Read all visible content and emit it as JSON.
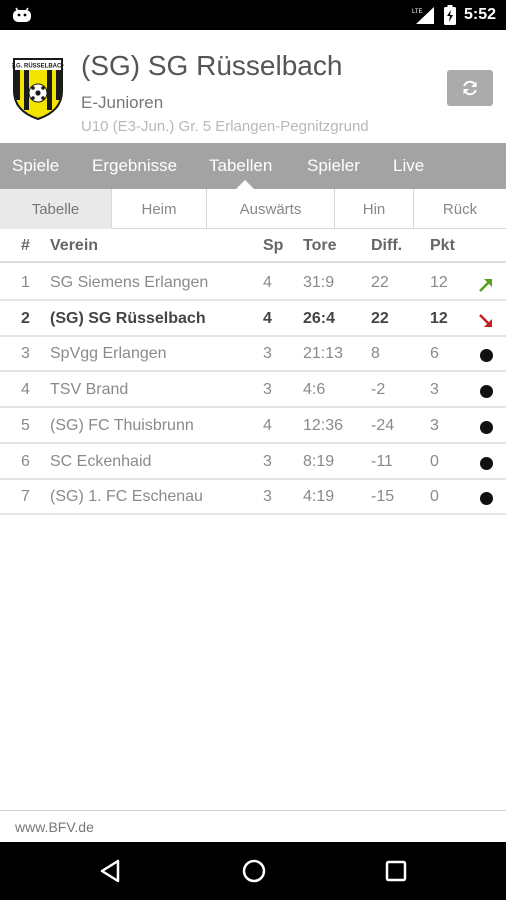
{
  "status_bar": {
    "time": "5:52",
    "network": "LTE"
  },
  "header": {
    "logo_text": "S.G. RÜSSELBACH",
    "club_name": "(SG) SG Rüsselbach",
    "team": "E-Junioren",
    "league": "U10 (E3-Jun.) Gr. 5 Erlangen-Pegnitzgrund",
    "refresh_icon": "refresh-icon"
  },
  "nav": {
    "tabs": [
      {
        "label": "Spiele"
      },
      {
        "label": "Ergebnisse"
      },
      {
        "label": "Tabellen"
      },
      {
        "label": "Spieler"
      },
      {
        "label": "Live"
      }
    ],
    "active": "Tabellen"
  },
  "subtabs": {
    "items": [
      {
        "label": "Tabelle"
      },
      {
        "label": "Heim"
      },
      {
        "label": "Auswärts"
      },
      {
        "label": "Hin"
      },
      {
        "label": "Rück"
      }
    ],
    "active": "Tabelle"
  },
  "table": {
    "columns": [
      "#",
      "Verein",
      "Sp",
      "Tore",
      "Diff.",
      "Pkt"
    ],
    "rows": [
      {
        "rank": "1",
        "team": "SG Siemens Erlangen",
        "sp": "4",
        "tore": "31:9",
        "diff": "22",
        "pkt": "12",
        "trend": "up"
      },
      {
        "rank": "2",
        "team": "(SG) SG Rüsselbach",
        "sp": "4",
        "tore": "26:4",
        "diff": "22",
        "pkt": "12",
        "trend": "down"
      },
      {
        "rank": "3",
        "team": "SpVgg Erlangen",
        "sp": "3",
        "tore": "21:13",
        "diff": "8",
        "pkt": "6",
        "trend": "same"
      },
      {
        "rank": "4",
        "team": "TSV Brand",
        "sp": "3",
        "tore": "4:6",
        "diff": "-2",
        "pkt": "3",
        "trend": "same"
      },
      {
        "rank": "5",
        "team": "(SG) FC Thuisbrunn",
        "sp": "4",
        "tore": "12:36",
        "diff": "-24",
        "pkt": "3",
        "trend": "same"
      },
      {
        "rank": "6",
        "team": "SC Eckenhaid",
        "sp": "3",
        "tore": "8:19",
        "diff": "-11",
        "pkt": "0",
        "trend": "same"
      },
      {
        "rank": "7",
        "team": "(SG) 1. FC Eschenau",
        "sp": "3",
        "tore": "4:19",
        "diff": "-15",
        "pkt": "0",
        "trend": "same"
      }
    ],
    "highlight_row": 1,
    "colors": {
      "up": "#5a9e1e",
      "down": "#c0201e",
      "same": "#111111"
    }
  },
  "footer": {
    "text": "www.BFV.de"
  }
}
